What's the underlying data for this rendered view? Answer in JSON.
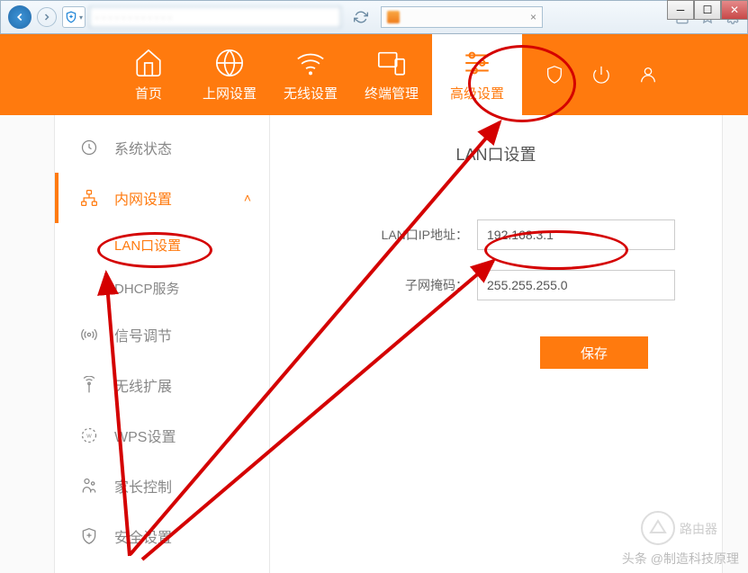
{
  "browser": {
    "url_display": "· · · · · · · · · · · ·",
    "tab_title": ""
  },
  "nav": {
    "home": "首页",
    "wan": "上网设置",
    "wifi": "无线设置",
    "terminal": "终端管理",
    "advanced": "高级设置"
  },
  "sidebar": {
    "status": "系统状态",
    "lan": "内网设置",
    "lan_sub": "LAN口设置",
    "dhcp": "DHCP服务",
    "signal": "信号调节",
    "extend": "无线扩展",
    "wps": "WPS设置",
    "parental": "家长控制",
    "security": "安全设置"
  },
  "content": {
    "title": "LAN口设置",
    "ip_label": "LAN口IP地址：",
    "ip_value": "192.168.3.1",
    "mask_label": "子网掩码：",
    "mask_value": "255.255.255.0",
    "save": "保存"
  },
  "watermark": {
    "text": "头条 @制造科技原理",
    "brand": "路由器"
  }
}
